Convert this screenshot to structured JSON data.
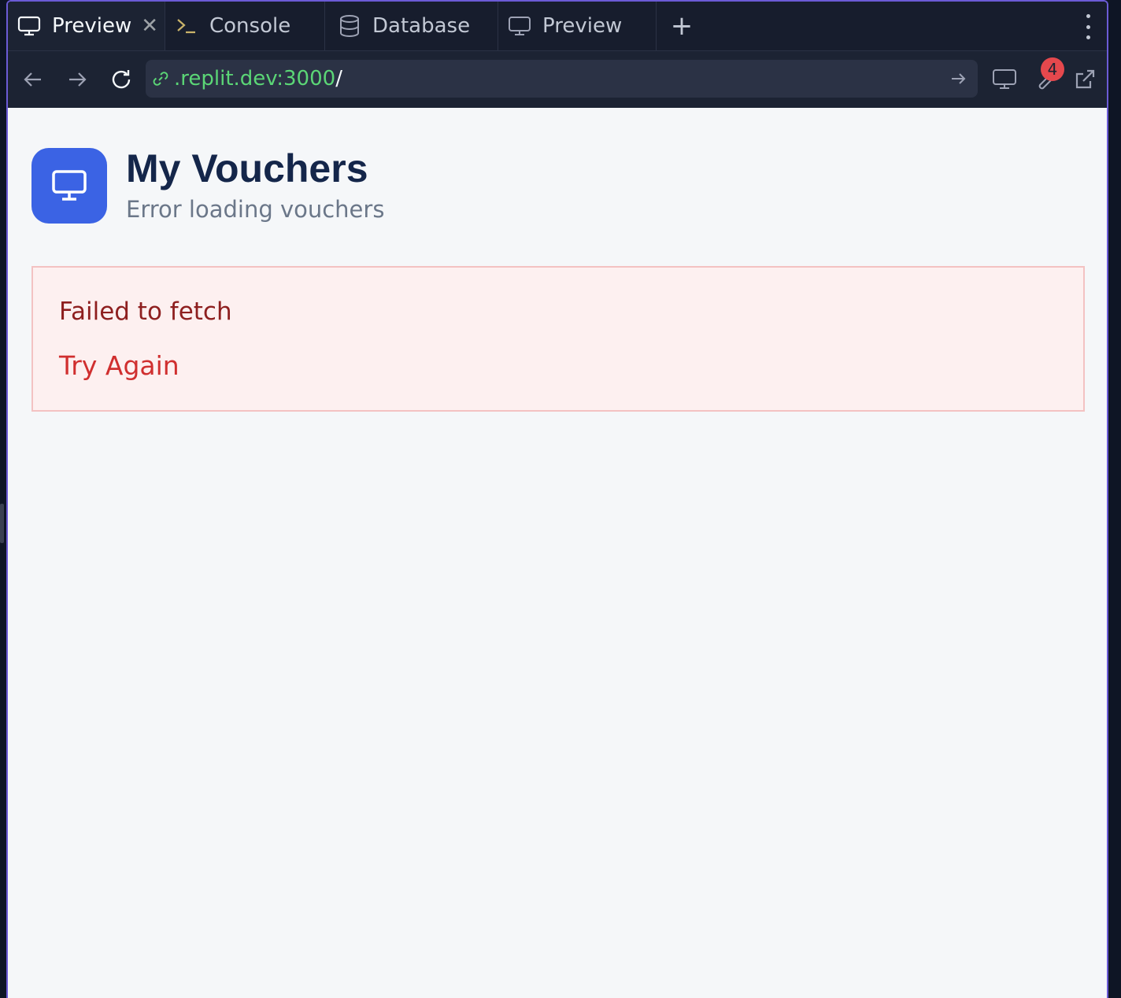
{
  "tabs": [
    {
      "label": "Preview",
      "icon": "monitor-icon",
      "active": true
    },
    {
      "label": "Console",
      "icon": "terminal-icon",
      "active": false
    },
    {
      "label": "Database",
      "icon": "database-icon",
      "active": false
    },
    {
      "label": "Preview",
      "icon": "monitor-icon",
      "active": false
    }
  ],
  "address": {
    "host": ".replit.dev:3000",
    "path": "/"
  },
  "toolbar": {
    "devtools_badge": "4"
  },
  "app": {
    "title": "My Vouchers",
    "subtitle": "Error loading vouchers",
    "icon": "monitor-icon",
    "accent": "#3b63e4"
  },
  "error": {
    "message": "Failed to fetch",
    "retry_label": "Try Again"
  }
}
